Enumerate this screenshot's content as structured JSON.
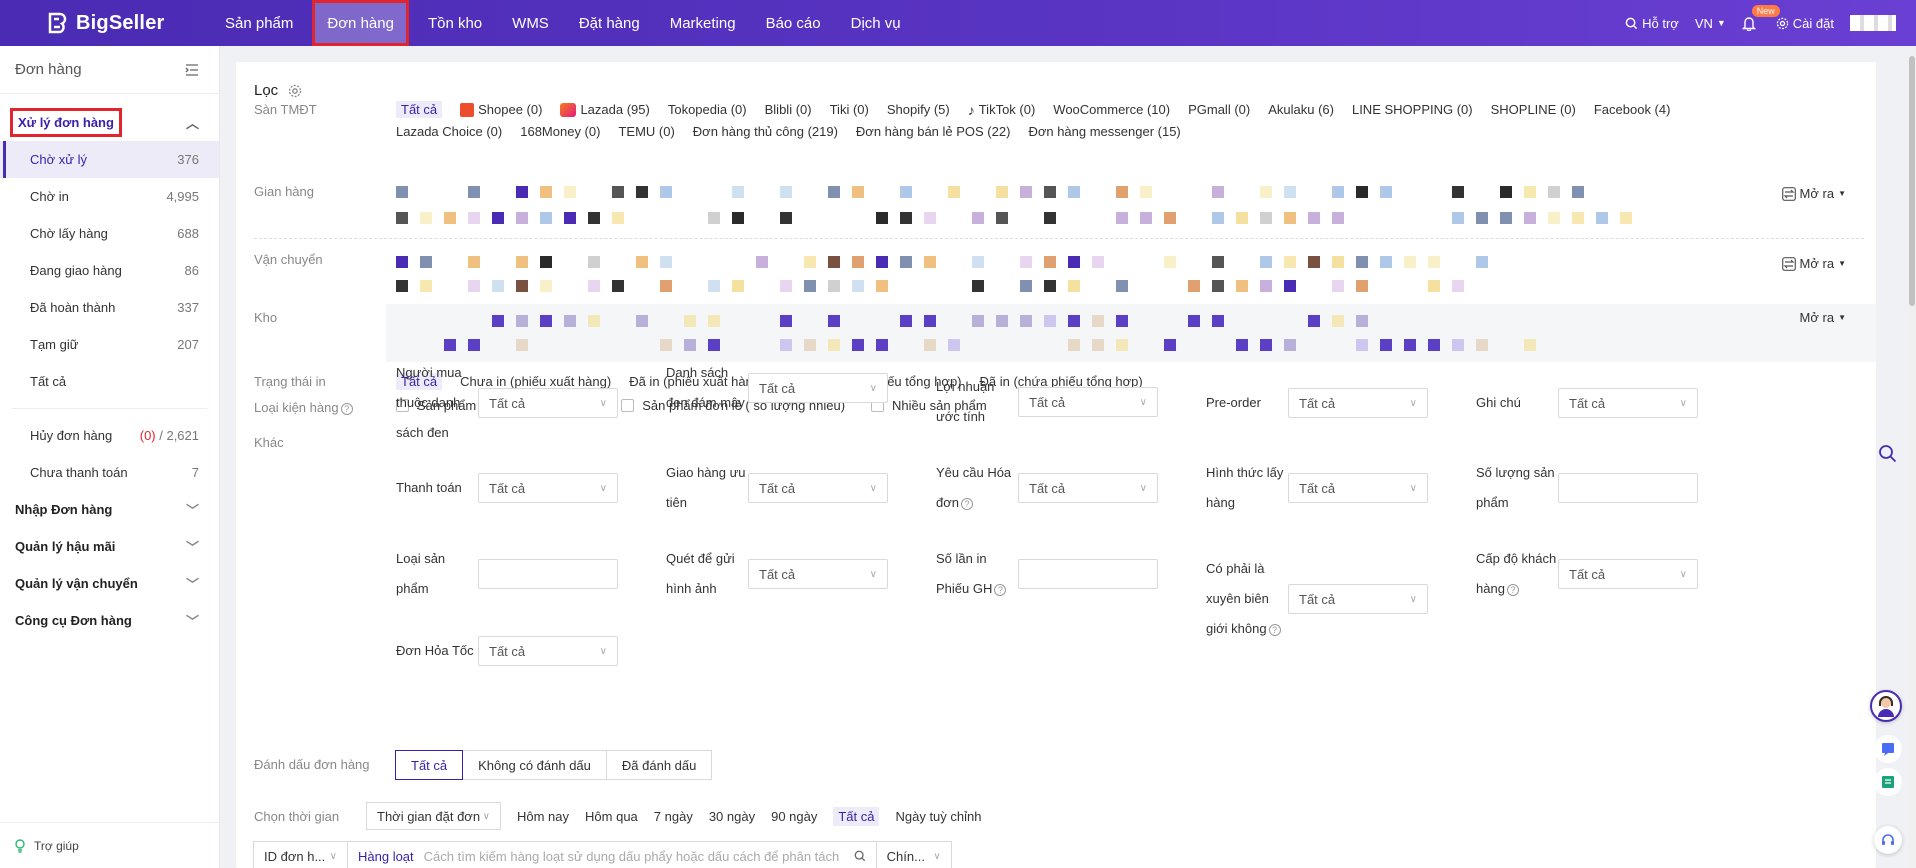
{
  "brand": {
    "name": "BigSeller"
  },
  "nav": {
    "items": [
      "Sản phẩm",
      "Đơn hàng",
      "Tồn kho",
      "WMS",
      "Đặt hàng",
      "Marketing",
      "Báo cáo",
      "Dịch vụ"
    ],
    "active_index": 1
  },
  "top_right": {
    "support": "Hỗ trợ",
    "lang": "VN",
    "new_badge": "New",
    "settings": "Cài đặt"
  },
  "sidebar": {
    "header": "Đơn hàng",
    "group_process": "Xử lý đơn hàng",
    "items": [
      {
        "label": "Chờ xử lý",
        "count": "376"
      },
      {
        "label": "Chờ in",
        "count": "4,995"
      },
      {
        "label": "Chờ lấy hàng",
        "count": "688"
      },
      {
        "label": "Đang giao hàng",
        "count": "86"
      },
      {
        "label": "Đã hoàn thành",
        "count": "337"
      },
      {
        "label": "Tạm giữ",
        "count": "207"
      },
      {
        "label": "Tất cả",
        "count": ""
      }
    ],
    "cancel": {
      "label": "Hủy đơn hàng",
      "red": "(0)",
      "rest": " / 2,621"
    },
    "unpaid": {
      "label": "Chưa thanh toán",
      "count": "7"
    },
    "groups": [
      "Nhập Đơn hàng",
      "Quản lý hậu mãi",
      "Quản lý vận chuyển",
      "Công cụ Đơn hàng"
    ],
    "footer": "Trợ giúp"
  },
  "filter": {
    "title": "Lọc",
    "labels": {
      "platform": "Sàn TMĐT",
      "store": "Gian hàng",
      "shipping": "Vận chuyển",
      "warehouse": "Kho",
      "print_status": "Trạng thái in",
      "package_type": "Loại kiện hàng",
      "other": "Khác",
      "mark": "Đánh dấu đơn hàng",
      "time": "Chọn thời gian"
    },
    "platforms": [
      "Tất cả",
      "Shopee (0)",
      "Lazada (95)",
      "Tokopedia (0)",
      "Blibli (0)",
      "Tiki (0)",
      "Shopify (5)",
      "TikTok (0)",
      "WooCommerce (10)",
      "PGmall (0)",
      "Akulaku (6)",
      "LINE SHOPPING (0)",
      "SHOPLINE (0)",
      "Facebook (4)",
      "Lazada Choice (0)",
      "168Money (0)",
      "TEMU (0)",
      "Đơn hàng thủ công (219)",
      "Đơn hàng bán lẻ POS (22)",
      "Đơn hàng messenger (15)"
    ],
    "expand": "Mở ra",
    "print_status": [
      "Tất cả",
      "Chưa in (phiếu xuất hàng)",
      "Đã in (phiếu xuất hàng)",
      "Chưa in (chứa phiếu tổng hợp)",
      "Đã in (chứa phiếu tổng hợp)"
    ],
    "package_types": [
      "Sản phẩm đơn lẻ ( số lượng 1)",
      "Sản phẩm đơn lẻ ( số lượng nhiều)",
      "Nhiều sản phẩm"
    ],
    "all": "Tất cả",
    "other_fields": {
      "buyer_list": "Người mua thuộc danh sách đen",
      "blacklist": "Danh sách đen đám mây",
      "profit": "Lợi nhuận ước tính",
      "preorder": "Pre-order",
      "note": "Ghi chú",
      "payment": "Thanh toán",
      "priority": "Giao hàng ưu tiên",
      "invoice": "Yêu cầu Hóa đơn",
      "pickup": "Hình thức lấy hàng",
      "qty": "Số lượng sản phẩm",
      "product_type": "Loại sản phẩm",
      "scan_photo": "Quét để gửi hình ảnh",
      "print_times": "Số lần in Phiếu GH",
      "cross_border": "Có phải là xuyên biên giới không",
      "customer_level": "Cấp độ khách hàng",
      "express": "Đơn Hỏa Tốc"
    },
    "marks": [
      "Tất cả",
      "Không có đánh dấu",
      "Đã đánh dấu"
    ],
    "time_select": "Thời gian đặt đơn",
    "time_options": [
      "Hôm nay",
      "Hôm qua",
      "7 ngày",
      "30 ngày",
      "90 ngày",
      "Tất cả",
      "Ngày tuỳ chỉnh"
    ],
    "search": {
      "field": "ID đơn h...",
      "bulk": "Hàng loạt",
      "placeholder": "Cách tìm kiếm hàng loạt sử dụng dấu phẩy hoặc dấu cách để phân tách",
      "mode": "Chín..."
    }
  }
}
